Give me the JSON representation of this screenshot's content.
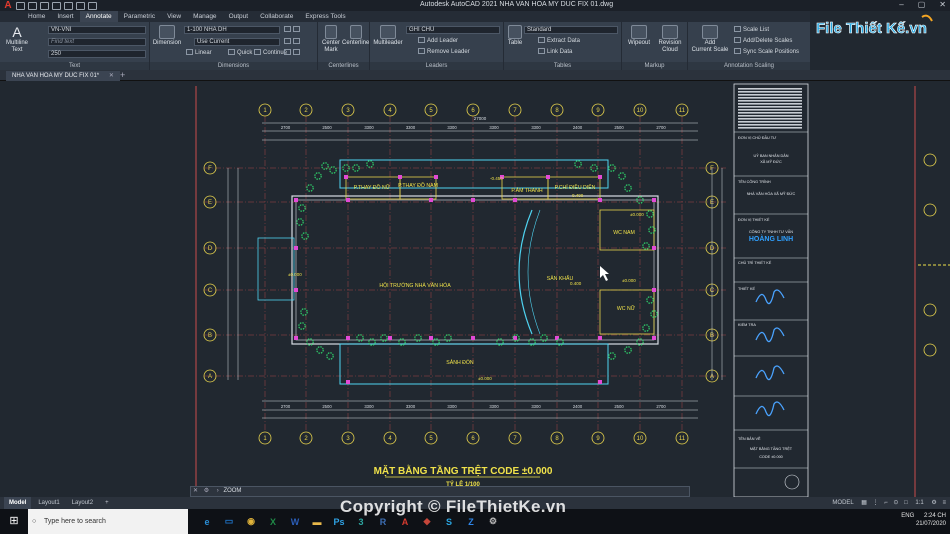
{
  "app": {
    "title": "Autodesk AutoCAD 2021    NHA VAN HOA MY DUC FIX 01.dwg",
    "brand_color": "#e23a2e",
    "accent": "#3b4452"
  },
  "ribbon_tabs": [
    "Home",
    "Insert",
    "Annotate",
    "Parametric",
    "View",
    "Manage",
    "Output",
    "Collaborate",
    "Express Tools"
  ],
  "ribbon": {
    "text_panel": {
      "title": "Text",
      "big_button": "Multiline\nText",
      "style": "VN-VNI",
      "find_placeholder": "Find text",
      "height": "250"
    },
    "dimensions_panel": {
      "title": "Dimensions",
      "big_button": "Dimension",
      "style": "1-100 NHA DH",
      "layer": "Use Current",
      "linear": "Linear",
      "quick": "Quick",
      "continue": "Continue"
    },
    "centerlines_panel": {
      "title": "Centerlines",
      "center_mark": "Center\nMark",
      "centerline": "Centerline"
    },
    "leaders_panel": {
      "title": "Leaders",
      "big_button": "Multileader",
      "style": "GHI CHU",
      "add": "Add Leader",
      "remove": "Remove Leader"
    },
    "tables_panel": {
      "title": "Tables",
      "big_button": "Table",
      "style": "Standard",
      "extract": "Extract Data",
      "link": "Link Data"
    },
    "markup_panel": {
      "title": "Markup",
      "wipeout": "Wipeout",
      "revision": "Revision\nCloud"
    },
    "scaling_panel": {
      "title": "Annotation Scaling",
      "big_button": "Add\nCurrent Scale",
      "scale_list": "Scale List",
      "add_delete": "Add/Delete Scales",
      "sync": "Sync Scale Positions"
    }
  },
  "logo_text": "File Thiết Kế.vn",
  "file_tab": "NHA VAN HOA MY DUC FIX 01*",
  "drawing": {
    "title": "MẶT BẰNG TẦNG TRỆT CODE ±0.000",
    "scale": "TỶ LỆ 1/100",
    "grid_cols": [
      "1",
      "2",
      "3",
      "4",
      "5",
      "6",
      "7",
      "8",
      "9",
      "10",
      "11"
    ],
    "grid_rows": [
      "F",
      "E",
      "D",
      "C",
      "B",
      "A"
    ],
    "rooms": [
      "P.THAY ĐỒ NỮ",
      "P.THAY ĐỒ NAM",
      "P.ÂM THANH",
      "P.CHỈ ĐIỀU DIỄN",
      "WC NAM",
      "HỘI TRƯỜNG NHÀ VĂN HÓA",
      "SÂN KHẤU",
      "WC NỮ",
      "SẢNH ĐÓN"
    ],
    "levels": [
      "±0.000",
      "-0.450",
      "0.400",
      "0.400",
      "±0.000",
      "±0.000",
      "±0.000"
    ],
    "total_dim": "27000",
    "dims_top": [
      "2700",
      "2500",
      "3300",
      "3300",
      "3300",
      "3300",
      "3300",
      "2400",
      "2500",
      "2700"
    ],
    "title_block": [
      "ĐƠN VỊ CHỦ ĐẦU TƯ",
      "UỶ BAN NHÂN DÂN",
      "XÃ MỸ ĐỨC",
      "TÊN CÔNG TRÌNH",
      "NHÀ VĂN HÓA XÃ MỸ ĐỨC",
      "ĐƠN VỊ THIẾT KẾ",
      "CÔNG TY TNHH TƯ VẤN",
      "HOÀNG LINH",
      "CHỦ TRÌ THIẾT KẾ",
      "THIẾT KẾ",
      "KIỂM TRA",
      "TÊN BẢN VẼ",
      "MẶT BẰNG TẦNG TRỆT",
      "CODE ±0.000"
    ]
  },
  "command": {
    "prompt": "ZOOM"
  },
  "layouts": [
    "Model",
    "Layout1",
    "Layout2"
  ],
  "status": {
    "mode": "MODEL",
    "scale": "1:1"
  },
  "taskbar": {
    "search_placeholder": "Type here to search",
    "apps": [
      "edge-icon",
      "explorer-icon",
      "chrome-icon",
      "excel-icon",
      "word-icon",
      "folder-icon",
      "photoshop-icon",
      "3dsmax-icon",
      "revit-icon",
      "autocad-icon",
      "sketchup-icon",
      "skype-icon",
      "zalo-icon",
      "settings-icon"
    ],
    "lang": "ENG",
    "time": "2:24 CH",
    "date": "21/07/2020"
  },
  "watermark": "Copyright © FileThietKe.vn"
}
